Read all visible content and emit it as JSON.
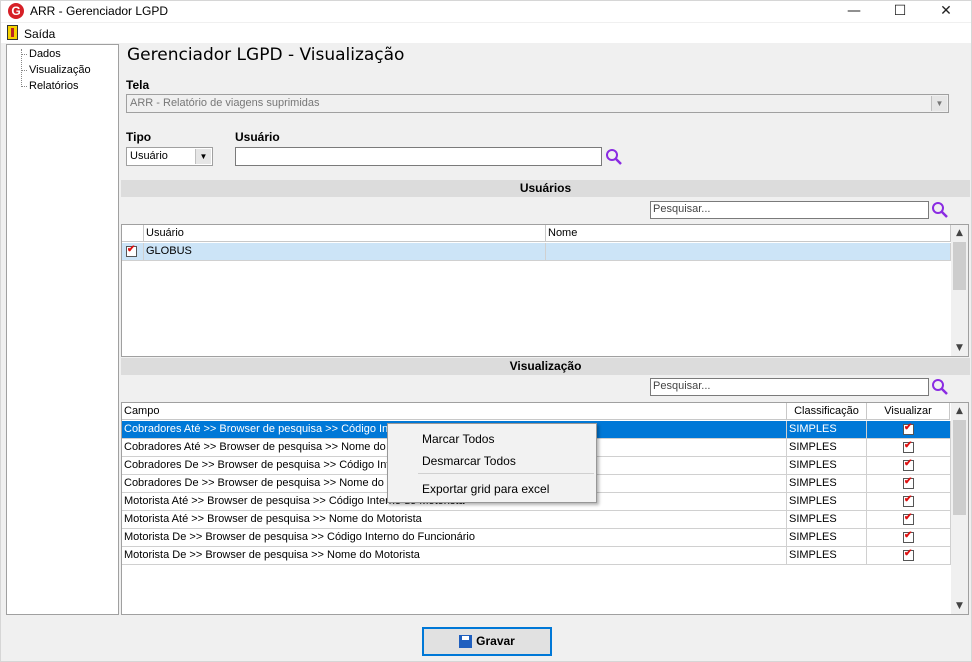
{
  "window": {
    "title": "ARR - Gerenciador LGPD",
    "app_letter": "G",
    "minimize": "—",
    "maximize": "☐",
    "close": "✕"
  },
  "menu": {
    "exit_label": "Saída"
  },
  "tree": {
    "items": [
      {
        "label": "Dados"
      },
      {
        "label": "Visualização"
      },
      {
        "label": "Relatórios"
      }
    ]
  },
  "main": {
    "heading": "Gerenciador LGPD - Visualização",
    "tela_label": "Tela",
    "tela_value": "ARR - Relatório de viagens suprimidas",
    "tipo_label": "Tipo",
    "tipo_value": "Usuário",
    "usuario_label": "Usuário",
    "usuario_value": ""
  },
  "users_section": {
    "title": "Usuários",
    "search_placeholder": "Pesquisar...",
    "columns": [
      "Usuário",
      "Nome"
    ],
    "rows": [
      {
        "usuario": "GLOBUS",
        "nome": "",
        "checked": true
      }
    ]
  },
  "view_section": {
    "title": "Visualização",
    "search_placeholder": "Pesquisar...",
    "columns": [
      "Campo",
      "Classificação",
      "Visualizar"
    ],
    "rows": [
      {
        "campo": "Cobradores Até >> Browser de pesquisa >> Código Interno do Funcionário",
        "classificacao": "SIMPLES",
        "visualizar": true
      },
      {
        "campo": "Cobradores Até >> Browser de pesquisa >> Nome do Cobrador",
        "classificacao": "SIMPLES",
        "visualizar": true
      },
      {
        "campo": "Cobradores De >> Browser de pesquisa >> Código Interno do Funcionário",
        "classificacao": "SIMPLES",
        "visualizar": true
      },
      {
        "campo": "Cobradores De >> Browser de pesquisa >> Nome do Cobrador",
        "classificacao": "SIMPLES",
        "visualizar": true
      },
      {
        "campo": "Motorista Até >> Browser de pesquisa >> Código Interno do Motorista",
        "classificacao": "SIMPLES",
        "visualizar": true
      },
      {
        "campo": "Motorista Até >> Browser de pesquisa >> Nome do Motorista",
        "classificacao": "SIMPLES",
        "visualizar": true
      },
      {
        "campo": "Motorista De >> Browser de pesquisa >> Código Interno do Funcionário",
        "classificacao": "SIMPLES",
        "visualizar": true
      },
      {
        "campo": "Motorista De >> Browser de pesquisa >> Nome do Motorista",
        "classificacao": "SIMPLES",
        "visualizar": true
      }
    ]
  },
  "context_menu": {
    "items": [
      "Marcar Todos",
      "Desmarcar Todos",
      "Exportar grid para excel"
    ]
  },
  "save_button": {
    "label": "Gravar"
  },
  "colors": {
    "selection": "#0078d7",
    "selection_light": "#cce4f7",
    "accent_icon": "#8a2be2"
  }
}
